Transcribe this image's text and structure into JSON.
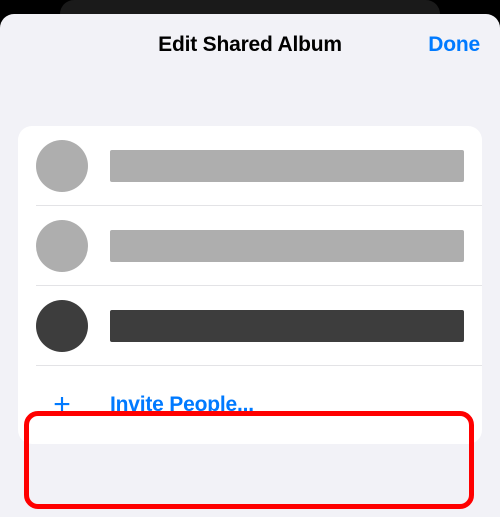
{
  "header": {
    "title": "Edit Shared Album",
    "done_label": "Done"
  },
  "subscribers": [
    {
      "tone": "light",
      "highlighted": false
    },
    {
      "tone": "light",
      "highlighted": false
    },
    {
      "tone": "dark",
      "highlighted": true
    }
  ],
  "invite": {
    "plus": "+",
    "label": "Invite People..."
  },
  "colors": {
    "accent": "#007aff",
    "placeholder_light": "#aeaeae",
    "placeholder_dark": "#3d3d3d",
    "highlight": "#ff0000"
  }
}
